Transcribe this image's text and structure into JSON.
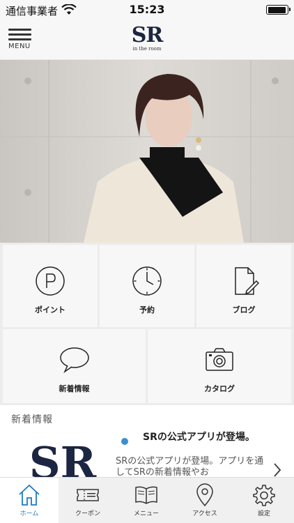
{
  "status": {
    "carrier": "通信事業者",
    "time": "15:23"
  },
  "header": {
    "menu_label": "MENU",
    "logo_text": "SR",
    "logo_sub": "in the room"
  },
  "tiles": [
    {
      "label": "ポイント",
      "icon": "point-icon"
    },
    {
      "label": "予約",
      "icon": "clock-icon"
    },
    {
      "label": "ブログ",
      "icon": "blog-icon"
    },
    {
      "label": "新着情報",
      "icon": "chat-bubble-icon"
    },
    {
      "label": "カタログ",
      "icon": "camera-icon"
    }
  ],
  "news": {
    "title": "新着情報",
    "thumb_text": "SR",
    "headline": "SRの公式アプリが登場。",
    "body": "SRの公式アプリが登場。アプリを通してSRの新着情報やお"
  },
  "tabs": [
    {
      "label": "ホーム",
      "icon": "home-icon",
      "active": true
    },
    {
      "label": "クーポン",
      "icon": "coupon-icon",
      "active": false
    },
    {
      "label": "メニュー",
      "icon": "book-icon",
      "active": false
    },
    {
      "label": "アクセス",
      "icon": "map-pin-icon",
      "active": false
    },
    {
      "label": "設定",
      "icon": "gear-icon",
      "active": false
    }
  ],
  "colors": {
    "accent": "#1d7bc0",
    "logo": "#1c2541",
    "dot": "#3a8fd0"
  }
}
